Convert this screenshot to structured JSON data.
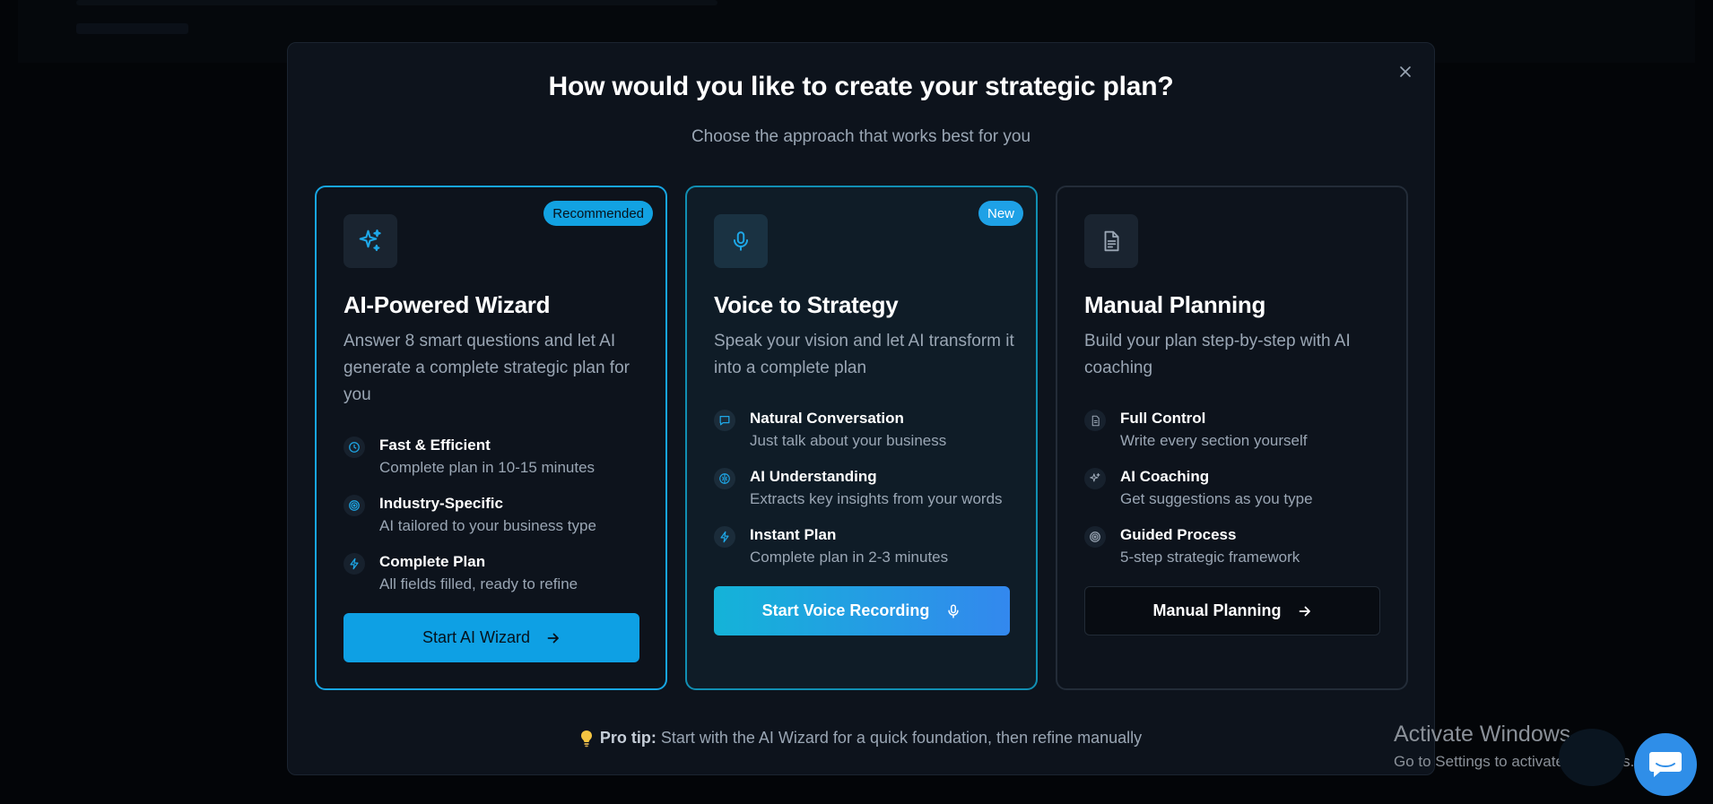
{
  "modal": {
    "title": "How would you like to create your strategic plan?",
    "subtitle": "Choose the approach that works best for you",
    "close_icon": "close-icon"
  },
  "cards": [
    {
      "badge": "Recommended",
      "icon": "sparkles-icon",
      "title": "AI-Powered Wizard",
      "description": "Answer 8 smart questions and let AI generate a complete strategic plan for you",
      "features": [
        {
          "icon": "clock-icon",
          "title": "Fast & Efficient",
          "subtitle": "Complete plan in 10-15 minutes"
        },
        {
          "icon": "target-icon",
          "title": "Industry-Specific",
          "subtitle": "AI tailored to your business type"
        },
        {
          "icon": "lightning-icon",
          "title": "Complete Plan",
          "subtitle": "All fields filled, ready to refine"
        }
      ],
      "cta": "Start AI Wizard",
      "cta_icon": "arrow-right-icon"
    },
    {
      "badge": "New",
      "icon": "microphone-icon",
      "title": "Voice to Strategy",
      "description": "Speak your vision and let AI transform it into a complete plan",
      "features": [
        {
          "icon": "chat-icon",
          "title": "Natural Conversation",
          "subtitle": "Just talk about your business"
        },
        {
          "icon": "brain-icon",
          "title": "AI Understanding",
          "subtitle": "Extracts key insights from your words"
        },
        {
          "icon": "lightning-icon",
          "title": "Instant Plan",
          "subtitle": "Complete plan in 2-3 minutes"
        }
      ],
      "cta": "Start Voice Recording",
      "cta_icon": "microphone-icon"
    },
    {
      "badge": "",
      "icon": "document-icon",
      "title": "Manual Planning",
      "description": "Build your plan step-by-step with AI coaching",
      "features": [
        {
          "icon": "document-icon",
          "title": "Full Control",
          "subtitle": "Write every section yourself"
        },
        {
          "icon": "sparkles-icon",
          "title": "AI Coaching",
          "subtitle": "Get suggestions as you type"
        },
        {
          "icon": "target-icon",
          "title": "Guided Process",
          "subtitle": "5-step strategic framework"
        }
      ],
      "cta": "Manual Planning",
      "cta_icon": "arrow-right-icon"
    }
  ],
  "pro_tip": {
    "icon": "lightbulb-icon",
    "label": "Pro tip:",
    "text": "Start with the AI Wizard for a quick foundation, then refine manually"
  },
  "os_watermark": {
    "line1": "Activate Windows",
    "line2": "Go to Settings to activate Windows."
  },
  "chat_widget": {
    "icon": "chat-bubble-icon"
  },
  "colors": {
    "accent": "#0ea0e4",
    "background": "#030508",
    "modal_bg": "#0d131c",
    "muted_text": "#9aa6b4"
  }
}
